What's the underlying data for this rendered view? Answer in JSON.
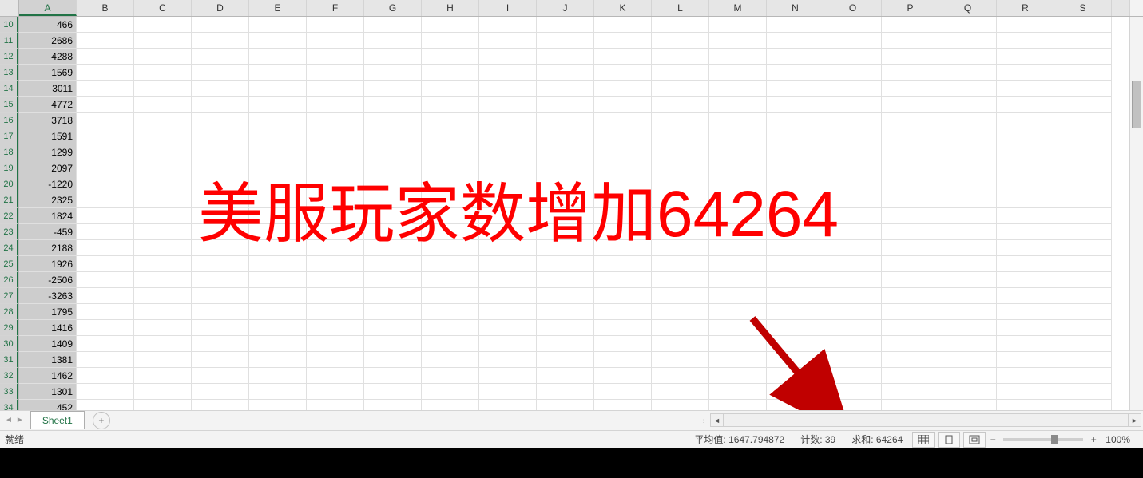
{
  "columns": [
    "A",
    "B",
    "C",
    "D",
    "E",
    "F",
    "G",
    "H",
    "I",
    "J",
    "K",
    "L",
    "M",
    "N",
    "O",
    "P",
    "Q",
    "R",
    "S"
  ],
  "selected_column_index": 0,
  "row_start": 10,
  "row_end": 34,
  "selected_rows": true,
  "col_a_values": {
    "10": 466,
    "11": 2686,
    "12": 4288,
    "13": 1569,
    "14": 3011,
    "15": 4772,
    "16": 3718,
    "17": 1591,
    "18": 1299,
    "19": 2097,
    "20": -1220,
    "21": 2325,
    "22": 1824,
    "23": -459,
    "24": 2188,
    "25": 1926,
    "26": -2506,
    "27": -3263,
    "28": 1795,
    "29": 1416,
    "30": 1409,
    "31": 1381,
    "32": 1462,
    "33": 1301,
    "34": 452
  },
  "overlay": {
    "text": "美服玩家数增加64264"
  },
  "tabs": {
    "sheet1": "Sheet1",
    "add_title": "新工作表"
  },
  "status": {
    "ready": "就绪",
    "avg_label": "平均值:",
    "avg_value": "1647.794872",
    "count_label": "计数:",
    "count_value": "39",
    "sum_label": "求和:",
    "sum_value": "64264",
    "zoom": "100%"
  }
}
